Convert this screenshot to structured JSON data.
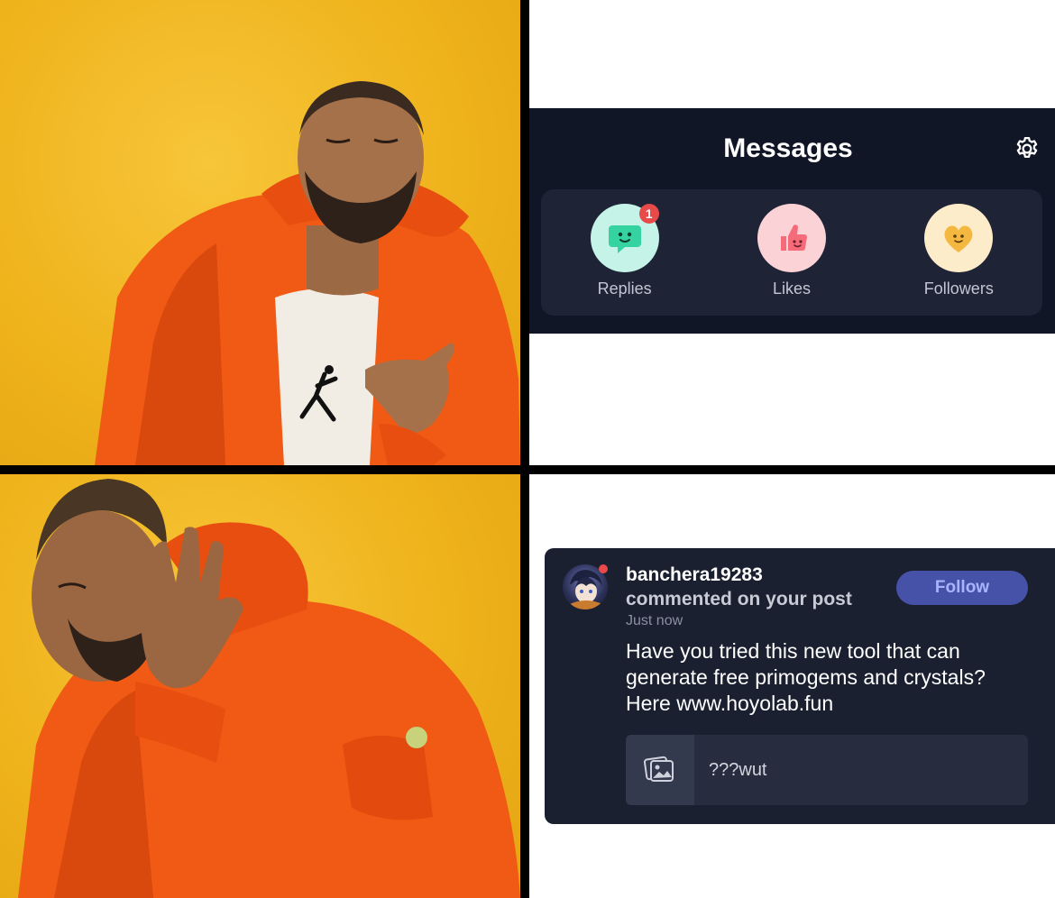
{
  "top_right": {
    "title": "Messages",
    "categories": [
      {
        "label": "Replies",
        "badge": "1"
      },
      {
        "label": "Likes"
      },
      {
        "label": "Followers"
      }
    ]
  },
  "bottom_right": {
    "username": "banchera19283",
    "action": "commented on your post",
    "time": "Just now",
    "follow_label": "Follow",
    "comment": "Have you tried this new tool that can generate free primogems and crystals? Here www.hoyolab.fun",
    "quoted_post": "???wut"
  },
  "colors": {
    "background_yellow": "#efb31c",
    "jacket_orange": "#f05a14",
    "card_dark": "#111626",
    "follow_button": "#4552a8",
    "badge_red": "#e84a4a"
  }
}
